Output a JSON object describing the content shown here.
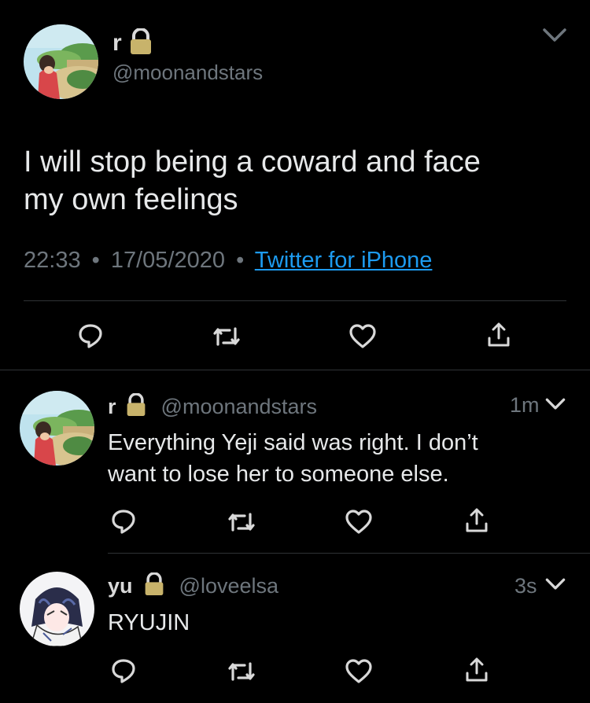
{
  "main_tweet": {
    "display_name": "r",
    "handle": "@moonandstars",
    "text_line1": "I will stop being a coward and face",
    "text_line2": "my own feelings",
    "time": "22:33",
    "separator": "•",
    "date": "17/05/2020",
    "source": "Twitter for iPhone",
    "colors": {
      "link": "#1d9bf0",
      "muted": "#6e767d",
      "text": "#d9d9d9"
    },
    "icons": [
      "lock-icon",
      "chevron-down-icon",
      "reply-icon",
      "retweet-icon",
      "like-icon",
      "share-icon"
    ]
  },
  "replies": [
    {
      "display_name": "r",
      "handle": "@moonandstars",
      "time": "1m",
      "text_line1": "Everything Yeji said was right. I don’t",
      "text_line2": "want to lose her to someone else."
    },
    {
      "display_name": "yu",
      "handle": "@loveelsa",
      "time": "3s",
      "text_line1": "RYUJIN"
    }
  ]
}
